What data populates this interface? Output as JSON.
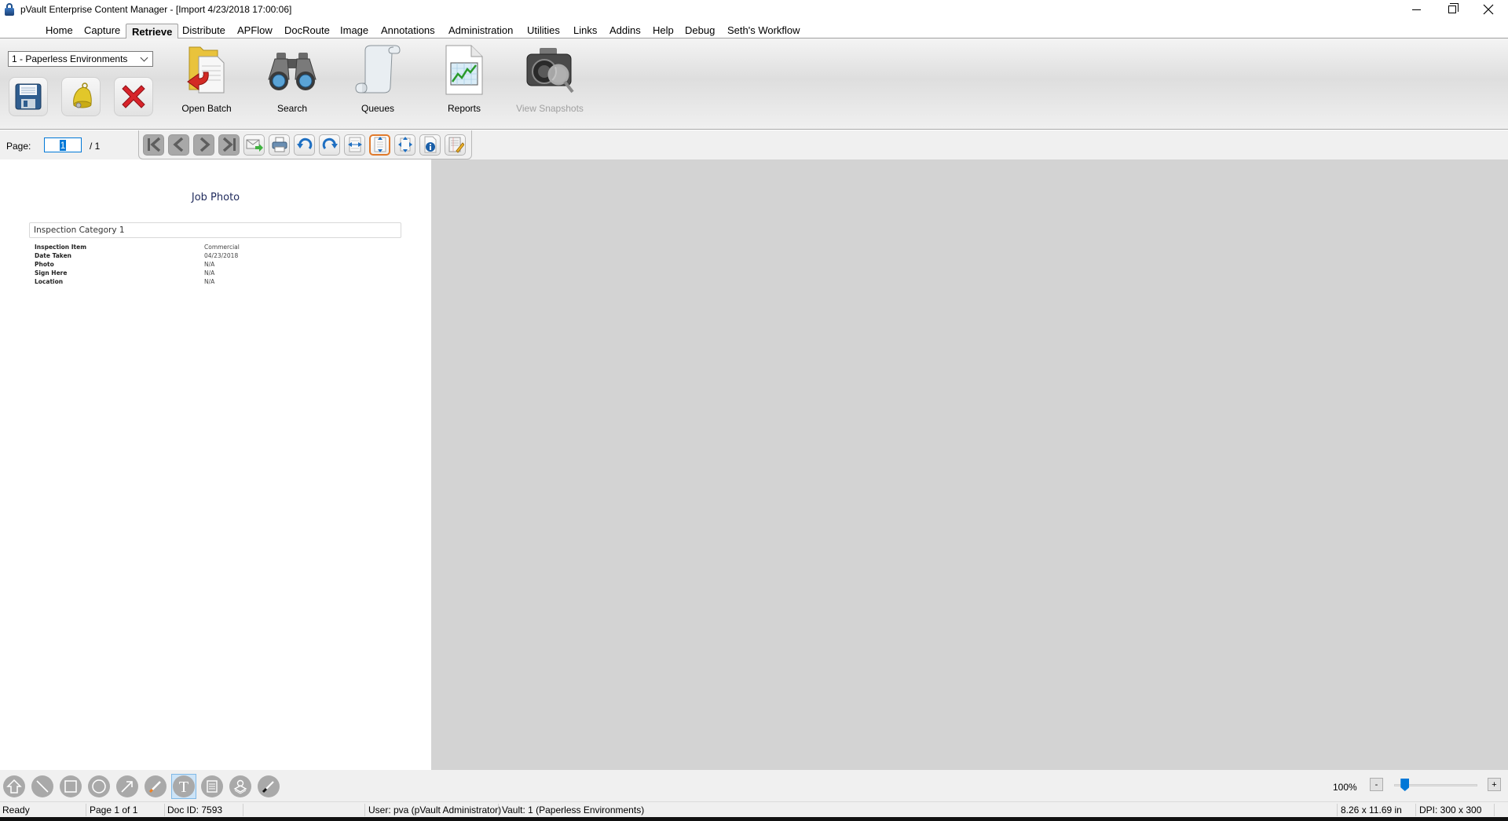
{
  "window": {
    "title": "pVault Enterprise Content Manager - [Import 4/23/2018 17:00:06]",
    "controls": [
      "minimize",
      "restore",
      "close"
    ]
  },
  "menu": {
    "tabs": [
      {
        "label": "Home"
      },
      {
        "label": "Capture"
      },
      {
        "label": "Retrieve",
        "active": true
      },
      {
        "label": "Distribute"
      },
      {
        "label": "APFlow"
      },
      {
        "label": "DocRoute"
      },
      {
        "label": "Image"
      },
      {
        "label": "Annotations"
      },
      {
        "label": "Administration"
      },
      {
        "label": "Utilities"
      },
      {
        "label": "Links"
      },
      {
        "label": "Addins"
      },
      {
        "label": "Help"
      },
      {
        "label": "Debug"
      },
      {
        "label": "Seth's Workflow"
      }
    ],
    "settings_icon": "gear-icon"
  },
  "ribbon": {
    "vault_select": "1 - Paperless Environments",
    "small_buttons": [
      {
        "name": "save",
        "icon": "floppy-disk-icon"
      },
      {
        "name": "notify",
        "icon": "bell-icon"
      },
      {
        "name": "delete",
        "icon": "red-x-icon"
      }
    ],
    "big_buttons": [
      {
        "label": "Open Batch",
        "icon": "folder-open-icon",
        "disabled": false
      },
      {
        "label": "Search",
        "icon": "binoculars-icon",
        "disabled": false
      },
      {
        "label": "Queues",
        "icon": "scroll-icon",
        "disabled": false
      },
      {
        "label": "Reports",
        "icon": "report-chart-icon",
        "disabled": false
      },
      {
        "label": "View Snapshots",
        "icon": "camera-magnifier-icon",
        "disabled": true
      }
    ]
  },
  "pagebar": {
    "page_label": "Page:",
    "page_value": "1",
    "page_total": "/ 1",
    "tools": [
      "first-page-icon",
      "previous-page-icon",
      "next-page-icon",
      "last-page-icon",
      "email-icon",
      "print-icon",
      "rotate-left-icon",
      "rotate-right-icon",
      "fit-width-icon",
      "fit-height-icon",
      "fit-page-icon",
      "info-icon",
      "edit-document-icon"
    ],
    "active_tool": "fit-height-icon"
  },
  "document": {
    "title": "Job Photo",
    "section": "Inspection Category 1",
    "fields": [
      {
        "label": "Inspection Item",
        "value": "Commercial"
      },
      {
        "label": "Date Taken",
        "value": "04/23/2018"
      },
      {
        "label": "Photo",
        "value": "N/A"
      },
      {
        "label": "Sign Here",
        "value": "N/A"
      },
      {
        "label": "Location",
        "value": "N/A"
      }
    ]
  },
  "annotations": {
    "tools": [
      "select-arrow-icon",
      "line-icon",
      "rectangle-icon",
      "ellipse-icon",
      "arrow-icon",
      "highlighter-icon",
      "text-icon",
      "note-icon",
      "stamp-icon",
      "pen-icon"
    ],
    "active_tool": "text-icon"
  },
  "zoom": {
    "percent": "100%",
    "minus": "-",
    "plus": "+",
    "slider_fraction": 0.13
  },
  "status": {
    "state": "Ready",
    "page": "Page 1 of 1",
    "doc_id": "Doc ID: 7593",
    "user": "User: pva (pVault Administrator)",
    "vault": "Vault: 1 (Paperless Environments)",
    "size": "8.26 x 11.69 in",
    "dpi": "DPI: 300 x 300"
  }
}
